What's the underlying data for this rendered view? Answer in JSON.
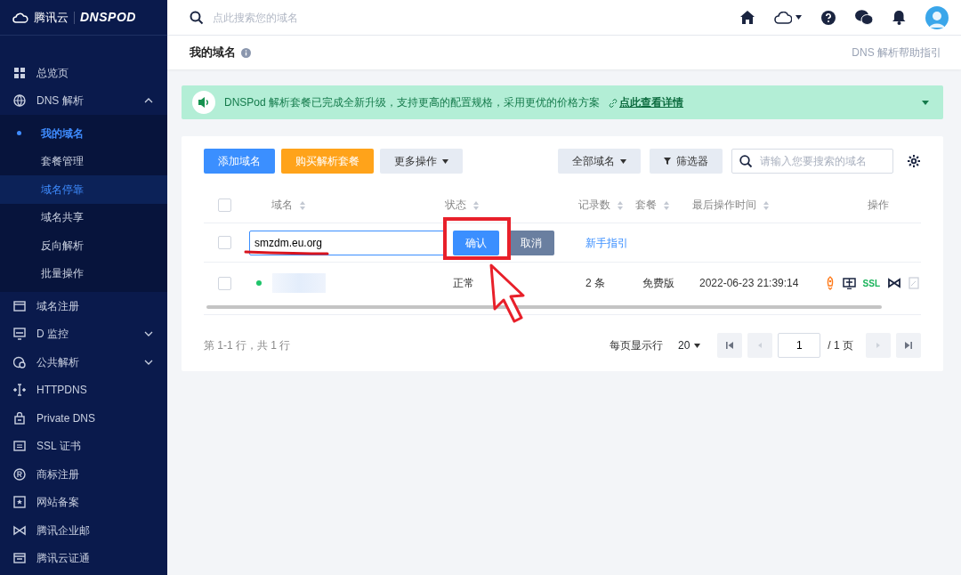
{
  "logo": {
    "brand": "腾讯云",
    "product": "DNSPOD"
  },
  "search": {
    "placeholder": "点此搜索您的域名"
  },
  "sidebar": {
    "items": [
      {
        "label": "总览页",
        "kind": "link"
      },
      {
        "label": "DNS 解析",
        "kind": "group",
        "expanded": true,
        "children": [
          {
            "label": "我的域名",
            "selected": true,
            "highlighted": false
          },
          {
            "label": "套餐管理",
            "selected": false,
            "highlighted": false
          },
          {
            "label": "域名停靠",
            "selected": false,
            "highlighted": true
          },
          {
            "label": "域名共享",
            "selected": false,
            "highlighted": false
          },
          {
            "label": "反向解析",
            "selected": false,
            "highlighted": false
          },
          {
            "label": "批量操作",
            "selected": false,
            "highlighted": false
          }
        ]
      },
      {
        "label": "域名注册",
        "kind": "link"
      },
      {
        "label": "D 监控",
        "kind": "group",
        "expanded": false
      },
      {
        "label": "公共解析",
        "kind": "group",
        "expanded": false
      },
      {
        "label": "HTTPDNS",
        "kind": "link"
      },
      {
        "label": "Private DNS",
        "kind": "link"
      },
      {
        "label": "SSL 证书",
        "kind": "link"
      },
      {
        "label": "商标注册",
        "kind": "link"
      },
      {
        "label": "网站备案",
        "kind": "link"
      },
      {
        "label": "腾讯企业邮",
        "kind": "link"
      },
      {
        "label": "腾讯云证通",
        "kind": "link"
      }
    ]
  },
  "page_header": {
    "title": "我的域名",
    "help_link": "DNS 解析帮助指引"
  },
  "banner": {
    "text": "DNSPod 解析套餐已完成全新升级，支持更高的配置规格，采用更优的价格方案",
    "link": "点此查看详情"
  },
  "toolbar": {
    "left": [
      {
        "label": "添加域名",
        "kind": "primary"
      },
      {
        "label": "购买解析套餐",
        "kind": "warning"
      },
      {
        "label": "更多操作",
        "kind": "dropdown"
      }
    ],
    "right": [
      {
        "label": "全部域名",
        "kind": "dropdown"
      },
      {
        "label": "筛选器",
        "kind": "filter"
      }
    ],
    "search": {
      "placeholder": "请输入您要搜索的域名"
    }
  },
  "table": {
    "columns": [
      {
        "label": "域名",
        "sortable": true
      },
      {
        "label": "状态",
        "sortable": true
      },
      {
        "label": "记录数",
        "sortable": true
      },
      {
        "label": "套餐",
        "sortable": true
      },
      {
        "label": "最后操作时间",
        "sortable": true
      },
      {
        "label": "操作",
        "sortable": false
      }
    ],
    "header_checked": false,
    "edit_row": {
      "checked": false,
      "value": "smzdm.eu.org",
      "confirm": "确认",
      "cancel": "取消",
      "guide_link": "新手指引"
    },
    "rows": [
      {
        "color": "#1fc46a",
        "status": "正常",
        "records": "2 条",
        "plan": "免费版",
        "last_modified": "2022-06-23 21:39:14",
        "ssl": "SSL",
        "checked": false
      }
    ]
  },
  "pagination": {
    "summary": "第 1-1 行，共 1 行",
    "per_page_label": "每页显示行",
    "per_page": "20",
    "page": "1",
    "total": "/ 1 页"
  },
  "annotations": [
    {
      "kind": "highlight-box"
    },
    {
      "kind": "underline"
    },
    {
      "kind": "arrow"
    }
  ]
}
